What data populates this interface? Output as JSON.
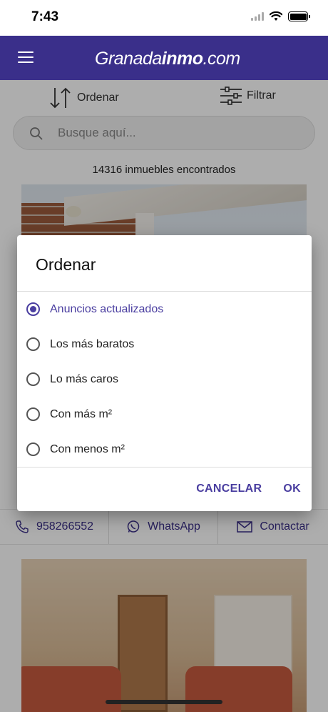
{
  "status_bar": {
    "time": "7:43"
  },
  "header": {
    "logo_light": "Granada",
    "logo_bold": "inmo",
    "logo_suffix": ".com"
  },
  "toolbar": {
    "sort_label": "Ordenar",
    "filter_label": "Filtrar"
  },
  "search": {
    "placeholder": "Busque aquí..."
  },
  "results": {
    "count_text": "14316 inmuebles encontrados"
  },
  "contact": {
    "phone": "958266552",
    "whatsapp": "WhatsApp",
    "contact": "Contactar"
  },
  "dialog": {
    "title": "Ordenar",
    "options": [
      {
        "label": "Anuncios actualizados",
        "selected": true
      },
      {
        "label": "Los más baratos",
        "selected": false
      },
      {
        "label": "Lo más caros",
        "selected": false
      },
      {
        "label": "Con más m²",
        "selected": false
      },
      {
        "label": "Con menos m²",
        "selected": false
      }
    ],
    "cancel_label": "CANCELAR",
    "ok_label": "OK"
  },
  "colors": {
    "brand": "#3a2f8a",
    "accent": "#4a3ea0"
  }
}
